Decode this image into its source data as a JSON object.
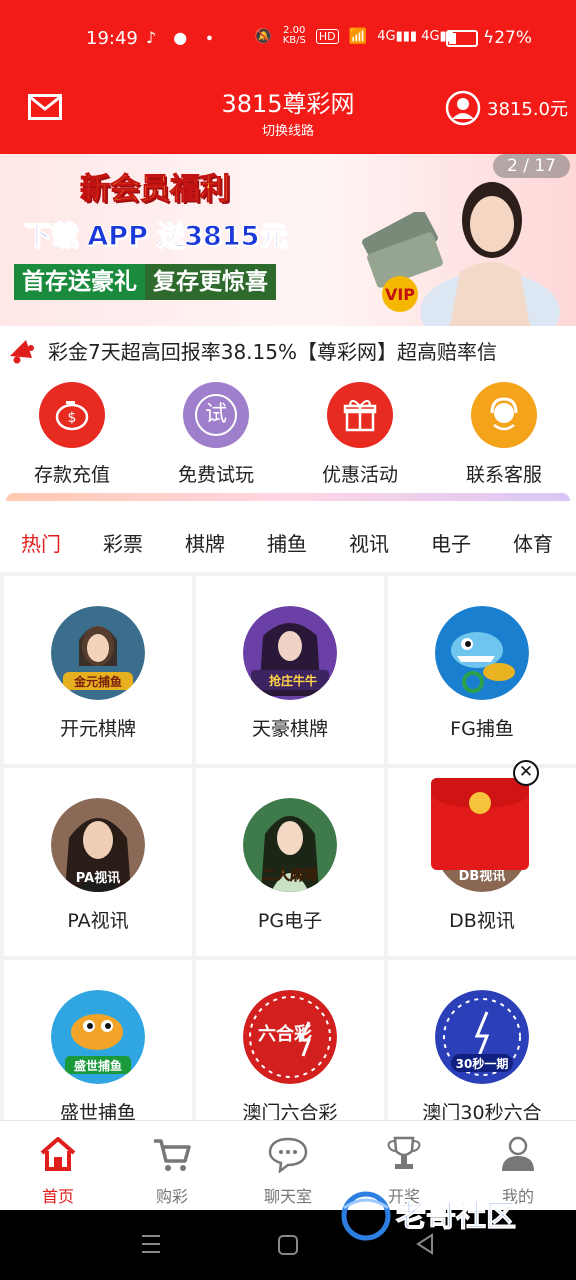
{
  "status": {
    "time": "19:49",
    "speed_value": "2.00",
    "speed_unit": "KB/S",
    "hd": "HD",
    "battery": "27%"
  },
  "header": {
    "title": "3815尊彩网",
    "subtitle": "切换线路",
    "balance": "3815.0元"
  },
  "banner": {
    "line1": "新会员福利",
    "line2": "下载 APP 送3815元",
    "line3a": "首存送豪礼",
    "line3b": "复存更惊喜",
    "pager": "2 / 17"
  },
  "notice": {
    "text": "彩金7天超高回报率38.15%【尊彩网】超高赔率信"
  },
  "quick_actions": [
    {
      "label": "存款充值",
      "icon": "piggy-bank-icon"
    },
    {
      "label": "免费试玩",
      "icon": "trial-icon",
      "glyph": "试"
    },
    {
      "label": "优惠活动",
      "icon": "gift-icon"
    },
    {
      "label": "联系客服",
      "icon": "customer-service-icon"
    }
  ],
  "categories": [
    "热门",
    "彩票",
    "棋牌",
    "捕鱼",
    "视讯",
    "电子",
    "体育"
  ],
  "games": [
    {
      "name": "开元棋牌",
      "badge": "金元捕鱼"
    },
    {
      "name": "天豪棋牌",
      "badge": "抢庄牛牛"
    },
    {
      "name": "FG捕鱼",
      "badge": ""
    },
    {
      "name": "PA视讯",
      "badge": "PA视讯"
    },
    {
      "name": "PG电子",
      "badge": "二人麻将"
    },
    {
      "name": "DB视讯",
      "badge": "DB视讯"
    },
    {
      "name": "盛世捕鱼",
      "badge": "盛世捕鱼"
    },
    {
      "name": "澳门六合彩",
      "badge": "六合彩"
    },
    {
      "name": "澳门30秒六合",
      "badge": "30秒一期"
    }
  ],
  "tabs": [
    {
      "label": "首页"
    },
    {
      "label": "购彩"
    },
    {
      "label": "聊天室"
    },
    {
      "label": "开奖"
    },
    {
      "label": "我的"
    }
  ],
  "watermark": "老哥社区",
  "colors": {
    "brand_red": "#f21b18",
    "active_red": "#e01e1e"
  }
}
